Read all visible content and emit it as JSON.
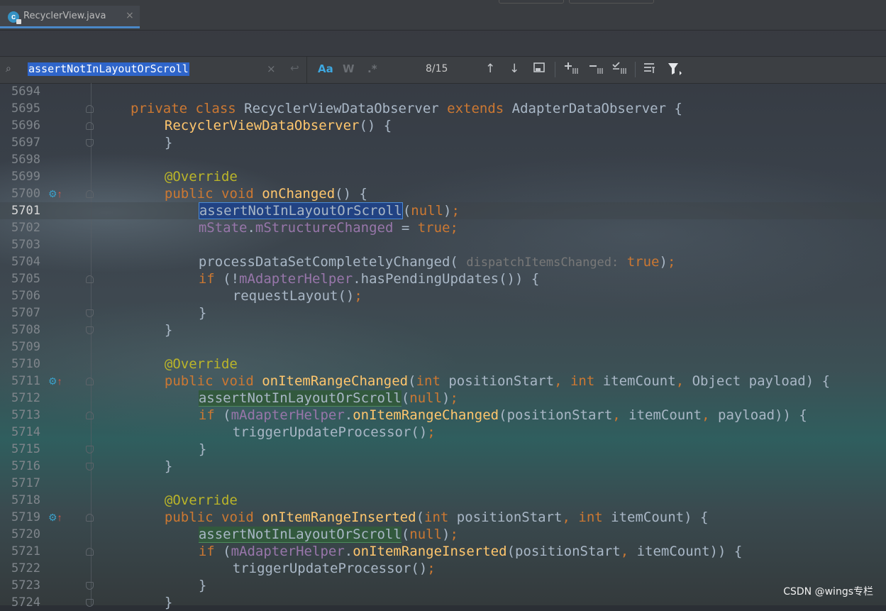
{
  "tab": {
    "file_name": "RecyclerView.java",
    "close_glyph": "×"
  },
  "search": {
    "icon": "search-icon",
    "query": "assertNotInLayoutOrScroll",
    "clear_glyph": "×",
    "newline_glyph": "↩",
    "match_case_label": "Aa",
    "words_label": "W",
    "regex_label": ".*",
    "match_count": "8/15",
    "toolbar_icons": [
      "prev-occurrence-icon",
      "next-occurrence-icon",
      "open-in-window-icon",
      "add-selection-icon",
      "remove-selection-icon",
      "select-all-occurrences-icon",
      "filter-search-results-icon",
      "filter-icon"
    ]
  },
  "editor": {
    "current_line": "5701",
    "lines": [
      {
        "num": "5694",
        "code": ""
      },
      {
        "num": "5695",
        "code": "private class RecyclerViewDataObserver extends AdapterDataObserver {"
      },
      {
        "num": "5696",
        "code": "RecyclerViewDataObserver() {"
      },
      {
        "num": "5697",
        "code": "}"
      },
      {
        "num": "5698",
        "code": ""
      },
      {
        "num": "5699",
        "code": "@Override"
      },
      {
        "num": "5700",
        "code": "public void onChanged() {"
      },
      {
        "num": "5701",
        "code": "assertNotInLayoutOrScroll(null);"
      },
      {
        "num": "5702",
        "code": "mState.mStructureChanged = true;"
      },
      {
        "num": "5703",
        "code": ""
      },
      {
        "num": "5704",
        "code": "processDataSetCompletelyChanged( dispatchItemsChanged: true);"
      },
      {
        "num": "5705",
        "code": "if (!mAdapterHelper.hasPendingUpdates()) {"
      },
      {
        "num": "5706",
        "code": "requestLayout();"
      },
      {
        "num": "5707",
        "code": "}"
      },
      {
        "num": "5708",
        "code": "}"
      },
      {
        "num": "5709",
        "code": ""
      },
      {
        "num": "5710",
        "code": "@Override"
      },
      {
        "num": "5711",
        "code": "public void onItemRangeChanged(int positionStart, int itemCount, Object payload) {"
      },
      {
        "num": "5712",
        "code": "assertNotInLayoutOrScroll(null);"
      },
      {
        "num": "5713",
        "code": "if (mAdapterHelper.onItemRangeChanged(positionStart, itemCount, payload)) {"
      },
      {
        "num": "5714",
        "code": "triggerUpdateProcessor();"
      },
      {
        "num": "5715",
        "code": "}"
      },
      {
        "num": "5716",
        "code": "}"
      },
      {
        "num": "5717",
        "code": ""
      },
      {
        "num": "5718",
        "code": "@Override"
      },
      {
        "num": "5719",
        "code": "public void onItemRangeInserted(int positionStart, int itemCount) {"
      },
      {
        "num": "5720",
        "code": "assertNotInLayoutOrScroll(null);"
      },
      {
        "num": "5721",
        "code": "if (mAdapterHelper.onItemRangeInserted(positionStart, itemCount)) {"
      },
      {
        "num": "5722",
        "code": "triggerUpdateProcessor();"
      },
      {
        "num": "5723",
        "code": "}"
      },
      {
        "num": "5724",
        "code": "}"
      }
    ]
  },
  "watermark": "CSDN @wings专栏",
  "colors": {
    "keyword": "#cc7832",
    "annotation": "#bbb529",
    "method": "#ffc66d",
    "field": "#9876aa",
    "default_text": "#a9b7c6",
    "search_highlight": "#32593d",
    "selected_match": "#214283"
  }
}
